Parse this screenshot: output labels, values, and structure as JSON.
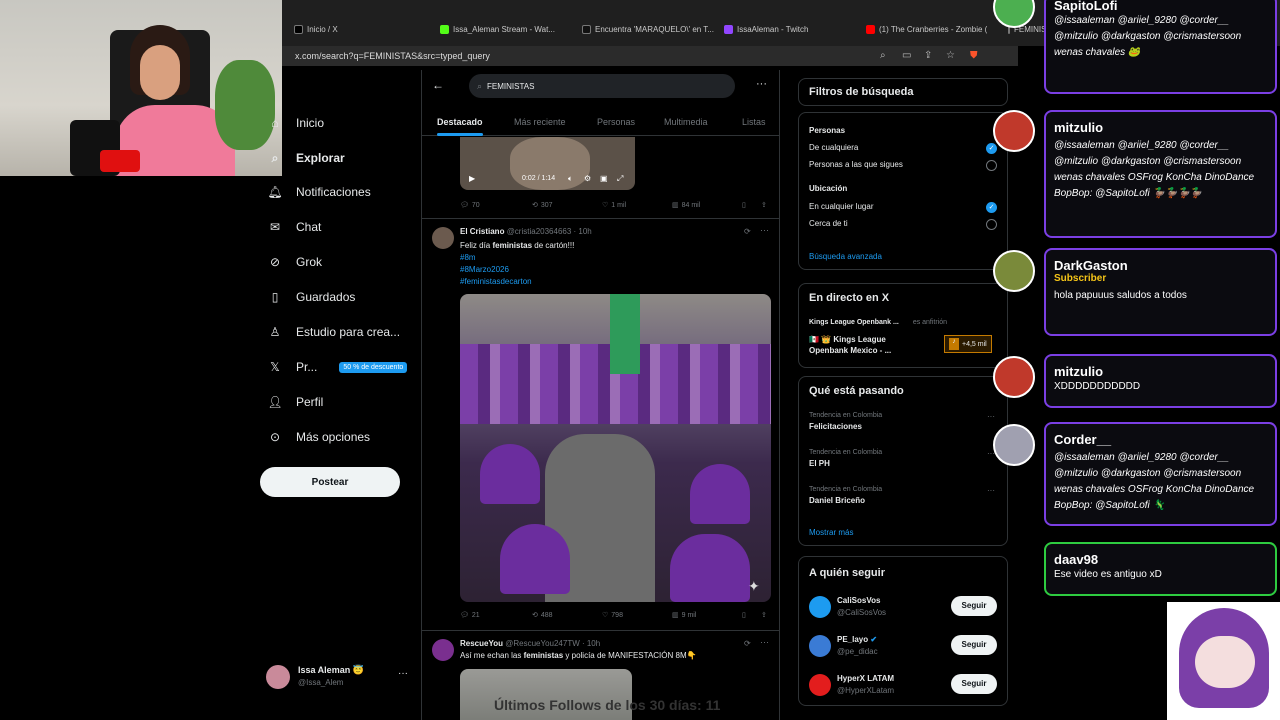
{
  "browser": {
    "tabs": [
      {
        "label": "Inicio / X",
        "color": "#000"
      },
      {
        "label": "Issa_Aleman Stream - Wat...",
        "color": "#53fc18"
      },
      {
        "label": "Encuentra 'MARAQUELO\\' en T...",
        "color": "#000"
      },
      {
        "label": "IssaAleman - Twitch",
        "color": "#9146ff"
      },
      {
        "label": "(1) The Cranberries - Zombie (",
        "color": "#ff0000"
      },
      {
        "label": "FEMINISTAS - Buscar / X",
        "color": "#000"
      }
    ],
    "url": "x.com/search?q=FEMINISTAS&src=typed_query"
  },
  "sidebar": {
    "items": [
      {
        "label": "Inicio",
        "icon": "home-icon"
      },
      {
        "label": "Explorar",
        "icon": "search-icon"
      },
      {
        "label": "Notificaciones",
        "icon": "bell-icon"
      },
      {
        "label": "Chat",
        "icon": "mail-icon"
      },
      {
        "label": "Grok",
        "icon": "grok-icon"
      },
      {
        "label": "Guardados",
        "icon": "bookmark-icon"
      },
      {
        "label": "Estudio para crea...",
        "icon": "creator-icon"
      },
      {
        "label": "Pr...",
        "icon": "x-logo-icon"
      },
      {
        "label": "Perfil",
        "icon": "person-icon"
      },
      {
        "label": "Más opciones",
        "icon": "more-icon"
      }
    ],
    "premium_badge": "50 % de descuento",
    "post_button": "Postear",
    "account": {
      "name": "Issa Aleman 😇",
      "handle": "@Issa_Alem"
    }
  },
  "search": {
    "query": "FEMINISTAS"
  },
  "feed_tabs": [
    "Destacado",
    "Más reciente",
    "Personas",
    "Multimedia",
    "Listas"
  ],
  "video": {
    "time": "0:02 / 1:14"
  },
  "post1_stats": {
    "replies": "70",
    "reposts": "307",
    "likes": "1 mil",
    "views": "84 mil"
  },
  "post2": {
    "name": "El Cristiano",
    "handle": "@cristia20364663 · 10h",
    "text_a": "Feliz día ",
    "text_b": "feministas",
    "text_c": " de cartón!!!",
    "tags": [
      "#8m",
      "#8Marzo2026",
      "#feministasdecarton"
    ],
    "stats": {
      "replies": "21",
      "reposts": "488",
      "likes": "798",
      "views": "9 mil"
    }
  },
  "post3": {
    "name": "RescueYou",
    "handle": "@RescueYou247TW · 10h",
    "text_a": "Así me echan las ",
    "text_b": "feministas",
    "text_c": " y policía de MANIFESTACIÓN 8M👇"
  },
  "filters": {
    "title": "Filtros de búsqueda",
    "people_label": "Personas",
    "people_opts": [
      "De cualquiera",
      "Personas a las que sigues"
    ],
    "loc_label": "Ubicación",
    "loc_opts": [
      "En cualquier lugar",
      "Cerca de ti"
    ],
    "advanced": "Búsqueda avanzada"
  },
  "live": {
    "title": "En directo en X",
    "host": "Kings League Openbank ...",
    "host_role": "es anfitrión",
    "stream_title": "🇲🇽 👑 Kings League Openbank Mexico - ...",
    "listeners": "+4,5 mil"
  },
  "trends": {
    "title": "Qué está pasando",
    "items": [
      {
        "ctx": "Tendencia en Colombia",
        "name": "Felicitaciones"
      },
      {
        "ctx": "Tendencia en Colombia",
        "name": "El PH"
      },
      {
        "ctx": "Tendencia en Colombia",
        "name": "Daniel Briceño"
      }
    ],
    "more": "Mostrar más"
  },
  "follow": {
    "title": "A quién seguir",
    "btn": "Seguir",
    "items": [
      {
        "name": "CaliSosVos",
        "handle": "@CaliSosVos",
        "color": "#1d9bf0"
      },
      {
        "name": "PE_layo",
        "handle": "@pe_didac",
        "color": "#3a7bd5"
      },
      {
        "name": "HyperX LATAM",
        "handle": "@HyperXLatam",
        "color": "#e31d1d"
      }
    ]
  },
  "chat": [
    {
      "user": "SapitoLofi",
      "text": "@issaaleman @ariiel_9280 @corder__ @mitzulio @darkgaston @crismastersoon wenas chavales 🐸"
    },
    {
      "user": "mitzulio",
      "text": "@issaaleman @ariiel_9280 @corder__ @mitzulio @darkgaston @crismastersoon wenas chavales OSFrog KonCha DinoDance BopBop: @SapitoLofi 🦆🦆🦆🦆"
    },
    {
      "user": "DarkGaston",
      "sub": "Subscriber",
      "text": "hola papuuus saludos a todos"
    },
    {
      "user": "mitzulio",
      "text": "XDDDDDDDDDDD"
    },
    {
      "user": "Corder__",
      "text": "@issaaleman @ariiel_9280 @corder__ @mitzulio @darkgaston @crismastersoon wenas chavales OSFrog KonCha DinoDance BopBop: @SapitoLofi 🦎"
    },
    {
      "user": "daav98",
      "text": "Ese video es antiguo xD"
    }
  ],
  "overlay": {
    "bottom_text": "Últimos Follows de los 30 días: 11"
  }
}
